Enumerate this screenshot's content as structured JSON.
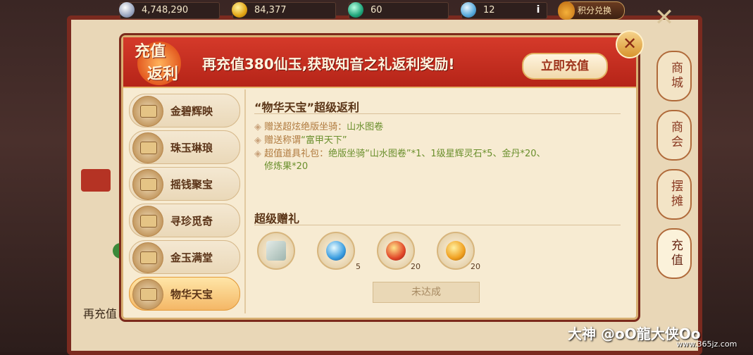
{
  "resources": {
    "silver": "4,748,290",
    "gold": "84,377",
    "jade": "60",
    "gem": "12",
    "info": "i",
    "points_exchange": "积分兑换"
  },
  "side_menu": [
    "商城",
    "商会",
    "摆摊",
    "充值"
  ],
  "background": {
    "left_text": "再充值"
  },
  "banner": {
    "emblem_top": "充值",
    "emblem_bottom": "返利",
    "text": "再充值380仙玉,获取知音之礼返利奖励!",
    "recharge_button": "立即充值",
    "close": "✕"
  },
  "tiers": [
    "金碧辉映",
    "珠玉琳琅",
    "摇钱聚宝",
    "寻珍觅奇",
    "金玉满堂",
    "物华天宝"
  ],
  "active_tier": "物华天宝",
  "content": {
    "title": "“物华天宝”超级返利",
    "lines": [
      {
        "prefix": "赠送超炫绝版坐骑：",
        "rest": "山水图卷"
      },
      {
        "prefix": "赠送称谓",
        "rest": "“富甲天下”"
      },
      {
        "prefix": "超值道具礼包：",
        "rest": "绝版坐骑“山水图卷”*1、1级星辉灵石*5、金丹*20、"
      },
      {
        "prefix": "",
        "rest": "修炼果*20"
      }
    ],
    "gift_title": "超级赠礼",
    "rewards": [
      {
        "icon": "scroll-icon",
        "count": ""
      },
      {
        "icon": "blue-gem-icon",
        "count": "5"
      },
      {
        "icon": "golden-elixir-icon",
        "count": "20"
      },
      {
        "icon": "cultivation-fruit-icon",
        "count": "20"
      }
    ],
    "status_button": "未达成"
  },
  "watermark": {
    "text": "大神 @oO龍大侠Oo",
    "url": "www.365jz.com"
  }
}
